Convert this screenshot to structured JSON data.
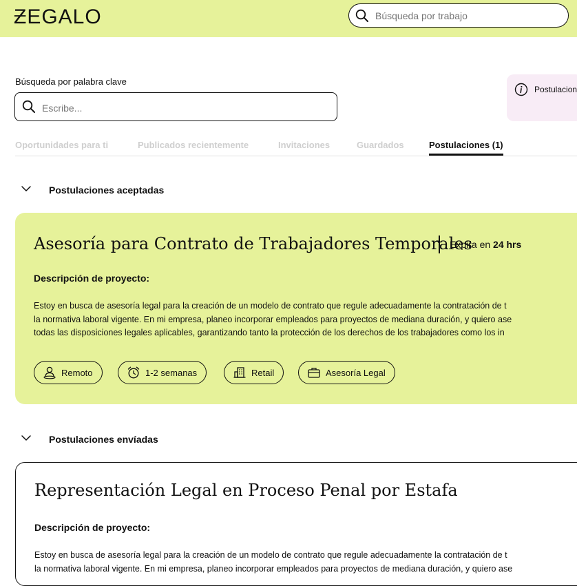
{
  "header": {
    "logo": "ƵEGALO",
    "search": {
      "placeholder": "Búsqueda por trabajo"
    },
    "search_icon": "search-icon"
  },
  "keyword_search": {
    "label": "Búsqueda por palabra clave",
    "placeholder": "Escribe...",
    "icon": "search-icon"
  },
  "info_banner": {
    "icon": "info-icon",
    "text": "Postulacion"
  },
  "tabs": [
    {
      "label": "Oportunidades para ti",
      "active": false
    },
    {
      "label": "Publicados recientemente",
      "active": false
    },
    {
      "label": "Invitaciones",
      "active": false
    },
    {
      "label": "Guardados",
      "active": false
    },
    {
      "label": "Postulaciones (1)",
      "active": true
    }
  ],
  "sections": {
    "accepted": {
      "heading": "Postulaciones aceptadas",
      "card": {
        "title": "Asesoría para Contrato de Trabajadores Temporales",
        "expira_prefix": "Expira en",
        "expira_value": "24 hrs",
        "description_label": "Descripción de proyecto:",
        "description_lines": [
          "Estoy en busca de asesoría legal para la creación de un modelo de contrato que regule adecuadamente la contratación de t",
          "la normativa laboral vigente. En mi empresa, planeo incorporar empleados para proyectos de mediana duración, y quiero ase",
          "todas las disposiciones legales aplicables, garantizando tanto la protección de los derechos de los trabajadores como los in"
        ],
        "tags": [
          {
            "icon": "person-location-icon",
            "label": "Remoto"
          },
          {
            "icon": "alarm-clock-icon",
            "label": "1-2 semanas"
          },
          {
            "icon": "building-icon",
            "label": "Retail"
          },
          {
            "icon": "briefcase-icon",
            "label": "Asesoría Legal"
          }
        ]
      }
    },
    "sent": {
      "heading": "Postulaciones envíadas",
      "card": {
        "title": "Representación Legal en Proceso Penal por Estafa",
        "description_label": "Descripción de proyecto:",
        "description_lines": [
          "Estoy en busca de asesoría legal para la creación de un modelo de contrato que regule adecuadamente la contratación de t",
          "la normativa laboral vigente. En mi empresa, planeo incorporar empleados para proyectos de mediana duración, y quiero ase"
        ]
      }
    }
  },
  "colors": {
    "brand_lime": "#e6f29a",
    "info_pink": "#f8ecf6",
    "text": "#111111",
    "tab_inactive": "#cfcfcf"
  }
}
